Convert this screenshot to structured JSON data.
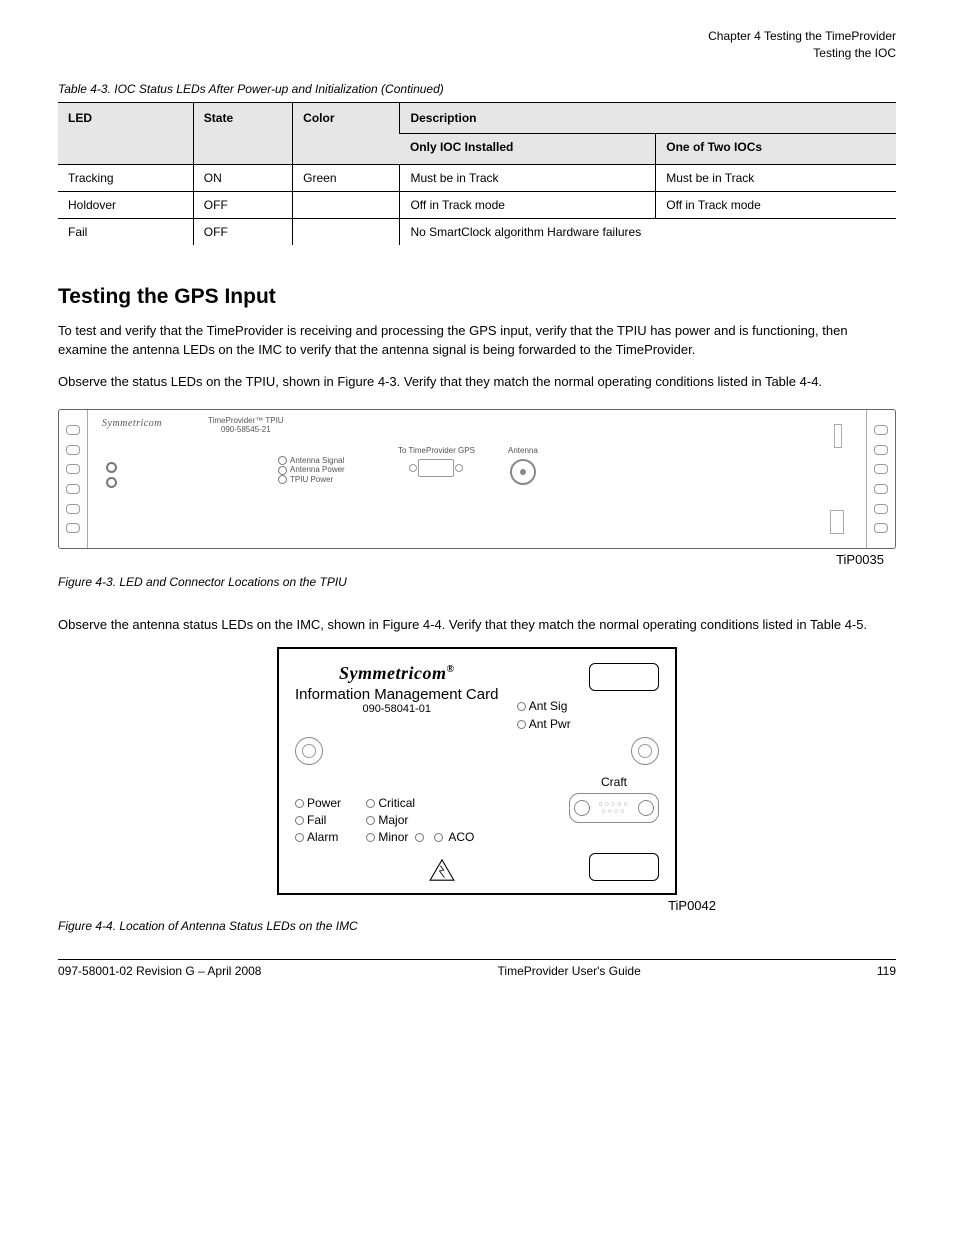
{
  "header": {
    "chapter": "Chapter 4 Testing the TimeProvider",
    "section": "Testing the IOC"
  },
  "table": {
    "caption": "Table 4-3. IOC Status LEDs After Power-up and Initialization (Continued)",
    "cols": {
      "led": "LED",
      "state": "State",
      "color": "Color",
      "desc_main": "Description",
      "desc_sub1": "Only IOC Installed",
      "desc_sub2": "One of Two IOCs"
    },
    "rows": [
      {
        "led": "Tracking",
        "state": "ON",
        "color": "Green",
        "desc1": "Must be in Track",
        "desc2": "Must be in Track"
      },
      {
        "led": "Holdover",
        "state": "OFF",
        "color": "",
        "desc1": "Off in Track mode",
        "desc2": "Off in Track mode"
      },
      {
        "led": "Fail",
        "state": "OFF",
        "color": "",
        "desc1": "No SmartClock algorithm Hardware failures",
        "desc2": ""
      }
    ]
  },
  "gps_section": {
    "heading": "Testing the GPS Input",
    "p1": "To test and verify that the TimeProvider is receiving and processing the GPS input, verify that the TPIU has power and is functioning, then examine the antenna LEDs on the IMC to verify that the antenna signal is being forwarded to the TimeProvider.",
    "p2": "Observe the status LEDs on the TPIU, shown in Figure 4-3. Verify that they match the normal operating conditions listed in Table 4-4."
  },
  "fig43": {
    "id": "TiP0035",
    "caption": "Figure 4-3. LED and Connector Locations on the TPIU",
    "labels": {
      "brand": "Symmetricom",
      "model": "TimeProvider™ TPIU",
      "part": "090-58545-21",
      "led1": "Antenna Signal",
      "led2": "Antenna Power",
      "led3": "TPIU Power",
      "conn1": "To TimeProvider GPS",
      "conn2": "Antenna"
    }
  },
  "imc_para": "Observe the antenna status LEDs on the IMC, shown in Figure 4-4. Verify that they match the normal operating conditions listed in Table 4-5.",
  "fig44": {
    "id": "TiP0042",
    "caption": "Figure 4-4. Location of Antenna Status LEDs on the IMC",
    "brand": "Symmetricom",
    "title": "Information Management Card",
    "part": "090-58041-01",
    "ant_sig": "Ant Sig",
    "ant_pwr": "Ant Pwr",
    "power": "Power",
    "fail": "Fail",
    "alarm": "Alarm",
    "critical": "Critical",
    "major": "Major",
    "minor": "Minor",
    "aco": "ACO",
    "craft": "Craft"
  },
  "footer": {
    "left": "097-58001-02 Revision G – April 2008",
    "center": "TimeProvider User's Guide",
    "right": "119"
  }
}
